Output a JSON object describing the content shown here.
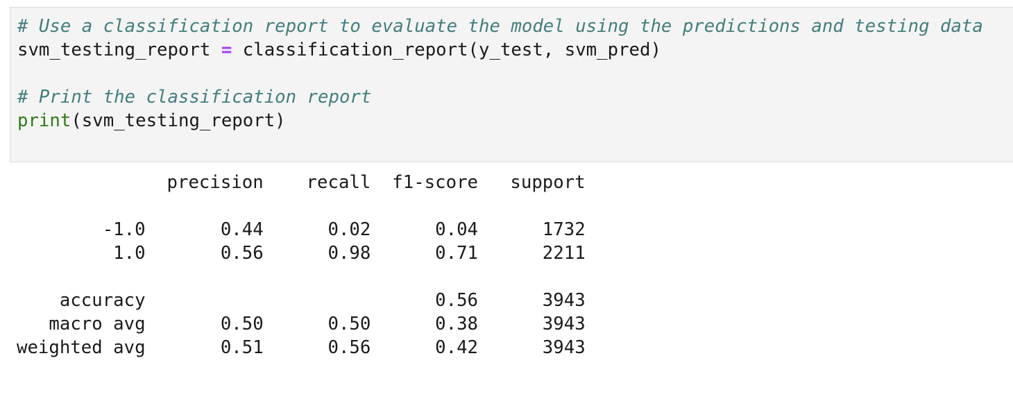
{
  "input": {
    "comment1": "# Use a classification report to evaluate the model using the predictions and testing data",
    "line2_var": "svm_testing_report",
    "line2_op": "=",
    "line2_call": "classification_report(y_test, svm_pred)",
    "comment2": "# Print the classification report",
    "line5_builtin": "print",
    "line5_args": "(svm_testing_report)"
  },
  "output": {
    "lines": [
      "              precision    recall  f1-score   support",
      "",
      "        -1.0       0.44      0.02      0.04      1732",
      "         1.0       0.56      0.98      0.71      2211",
      "",
      "    accuracy                           0.56      3943",
      "   macro avg       0.50      0.50      0.38      3943",
      "weighted avg       0.51      0.56      0.42      3943"
    ]
  }
}
